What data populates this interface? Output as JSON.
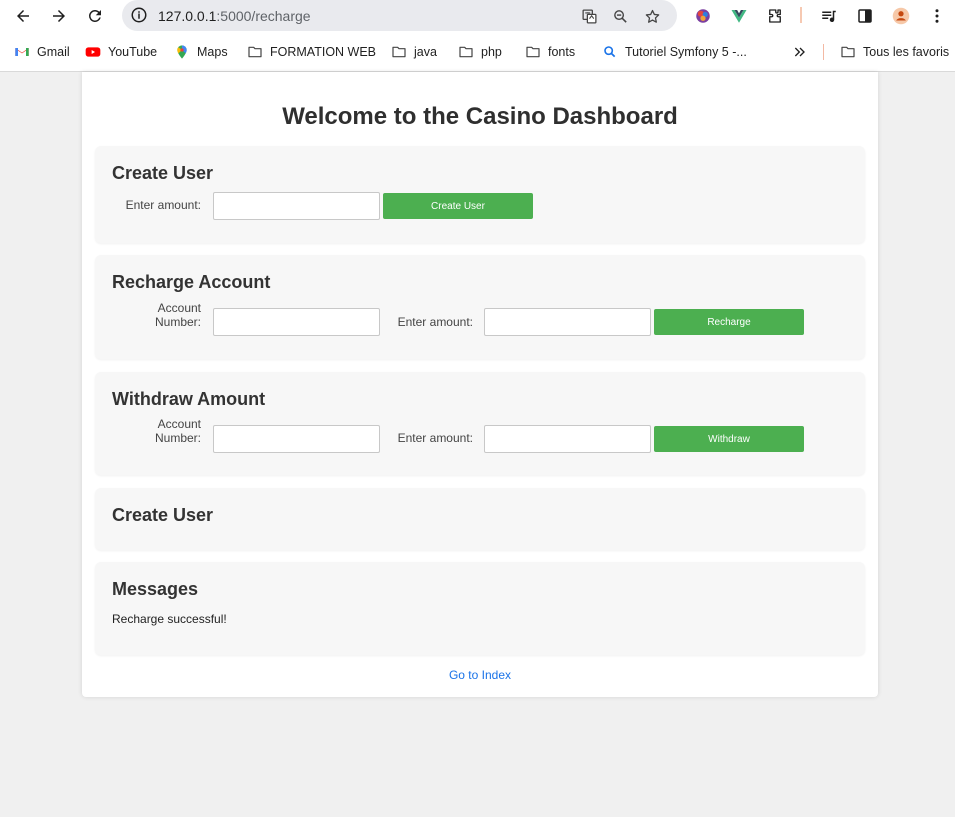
{
  "browser": {
    "url_host": "127.0.0.1",
    "url_rest": ":5000/recharge",
    "bookmarks": [
      {
        "label": "Gmail",
        "icon": "gmail-icon"
      },
      {
        "label": "YouTube",
        "icon": "youtube-icon"
      },
      {
        "label": "Maps",
        "icon": "maps-icon"
      },
      {
        "label": "FORMATION WEB",
        "icon": "folder-icon"
      },
      {
        "label": "java",
        "icon": "folder-icon"
      },
      {
        "label": "php",
        "icon": "folder-icon"
      },
      {
        "label": "fonts",
        "icon": "folder-icon"
      },
      {
        "label": "Tutoriel Symfony 5 -...",
        "icon": "search-icon"
      }
    ],
    "all_bookmarks_label": "Tous les favoris"
  },
  "page": {
    "title": "Welcome to the Casino Dashboard",
    "create_user": {
      "title": "Create User",
      "amount_label": "Enter amount:",
      "amount_value": "",
      "button_label": "Create User"
    },
    "recharge": {
      "title": "Recharge Account",
      "account_label_line1": "Account",
      "account_label_line2": "Number:",
      "account_value": "",
      "amount_label": "Enter amount:",
      "amount_value": "",
      "button_label": "Recharge"
    },
    "withdraw": {
      "title": "Withdraw Amount",
      "account_label_line1": "Account",
      "account_label_line2": "Number:",
      "account_value": "",
      "amount_label": "Enter amount:",
      "amount_value": "",
      "button_label": "Withdraw"
    },
    "create_user_result": {
      "title": "Create User"
    },
    "messages": {
      "title": "Messages",
      "text": "Recharge successful!"
    },
    "index_link": "Go to Index"
  },
  "colors": {
    "accent_green": "#4caf50",
    "link_blue": "#1a73e8",
    "page_bg": "#f0f0f0",
    "section_bg": "#f7f7f7"
  }
}
